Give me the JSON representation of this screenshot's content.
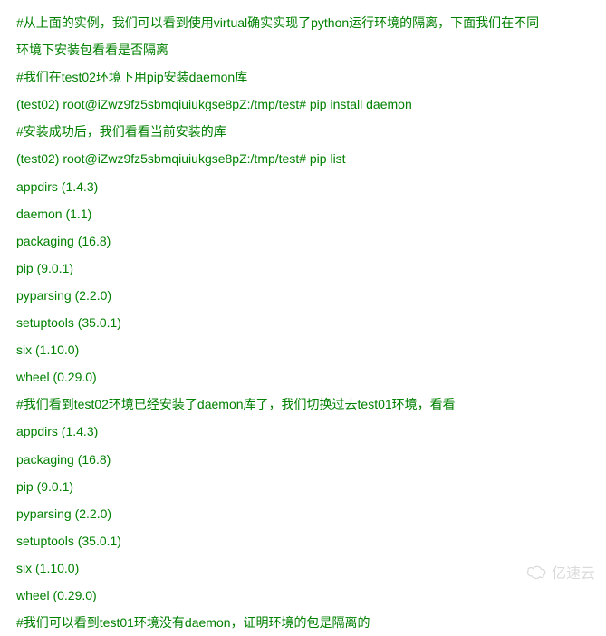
{
  "lines": [
    "#从上面的实例，我们可以看到使用virtual确实实现了python运行环境的隔离，下面我们在不同",
    "环境下安装包看看是否隔离",
    "#我们在test02环境下用pip安装daemon库",
    "(test02) root@iZwz9fz5sbmqiuiukgse8pZ:/tmp/test# pip install daemon",
    "#安装成功后，我们看看当前安装的库",
    "(test02) root@iZwz9fz5sbmqiuiukgse8pZ:/tmp/test# pip list",
    "appdirs (1.4.3)",
    "daemon (1.1)",
    "packaging (16.8)",
    "pip (9.0.1)",
    "pyparsing (2.2.0)",
    "setuptools (35.0.1)",
    "six (1.10.0)",
    "wheel (0.29.0)",
    "#我们看到test02环境已经安装了daemon库了，我们切换过去test01环境，看看",
    "appdirs (1.4.3)",
    "packaging (16.8)",
    "pip (9.0.1)",
    "pyparsing (2.2.0)",
    "setuptools (35.0.1)",
    "six (1.10.0)",
    "wheel (0.29.0)",
    "#我们可以看到test01环境没有daemon，证明环境的包是隔离的"
  ],
  "watermark": {
    "text": "亿速云",
    "icon_name": "cloud-icon"
  }
}
